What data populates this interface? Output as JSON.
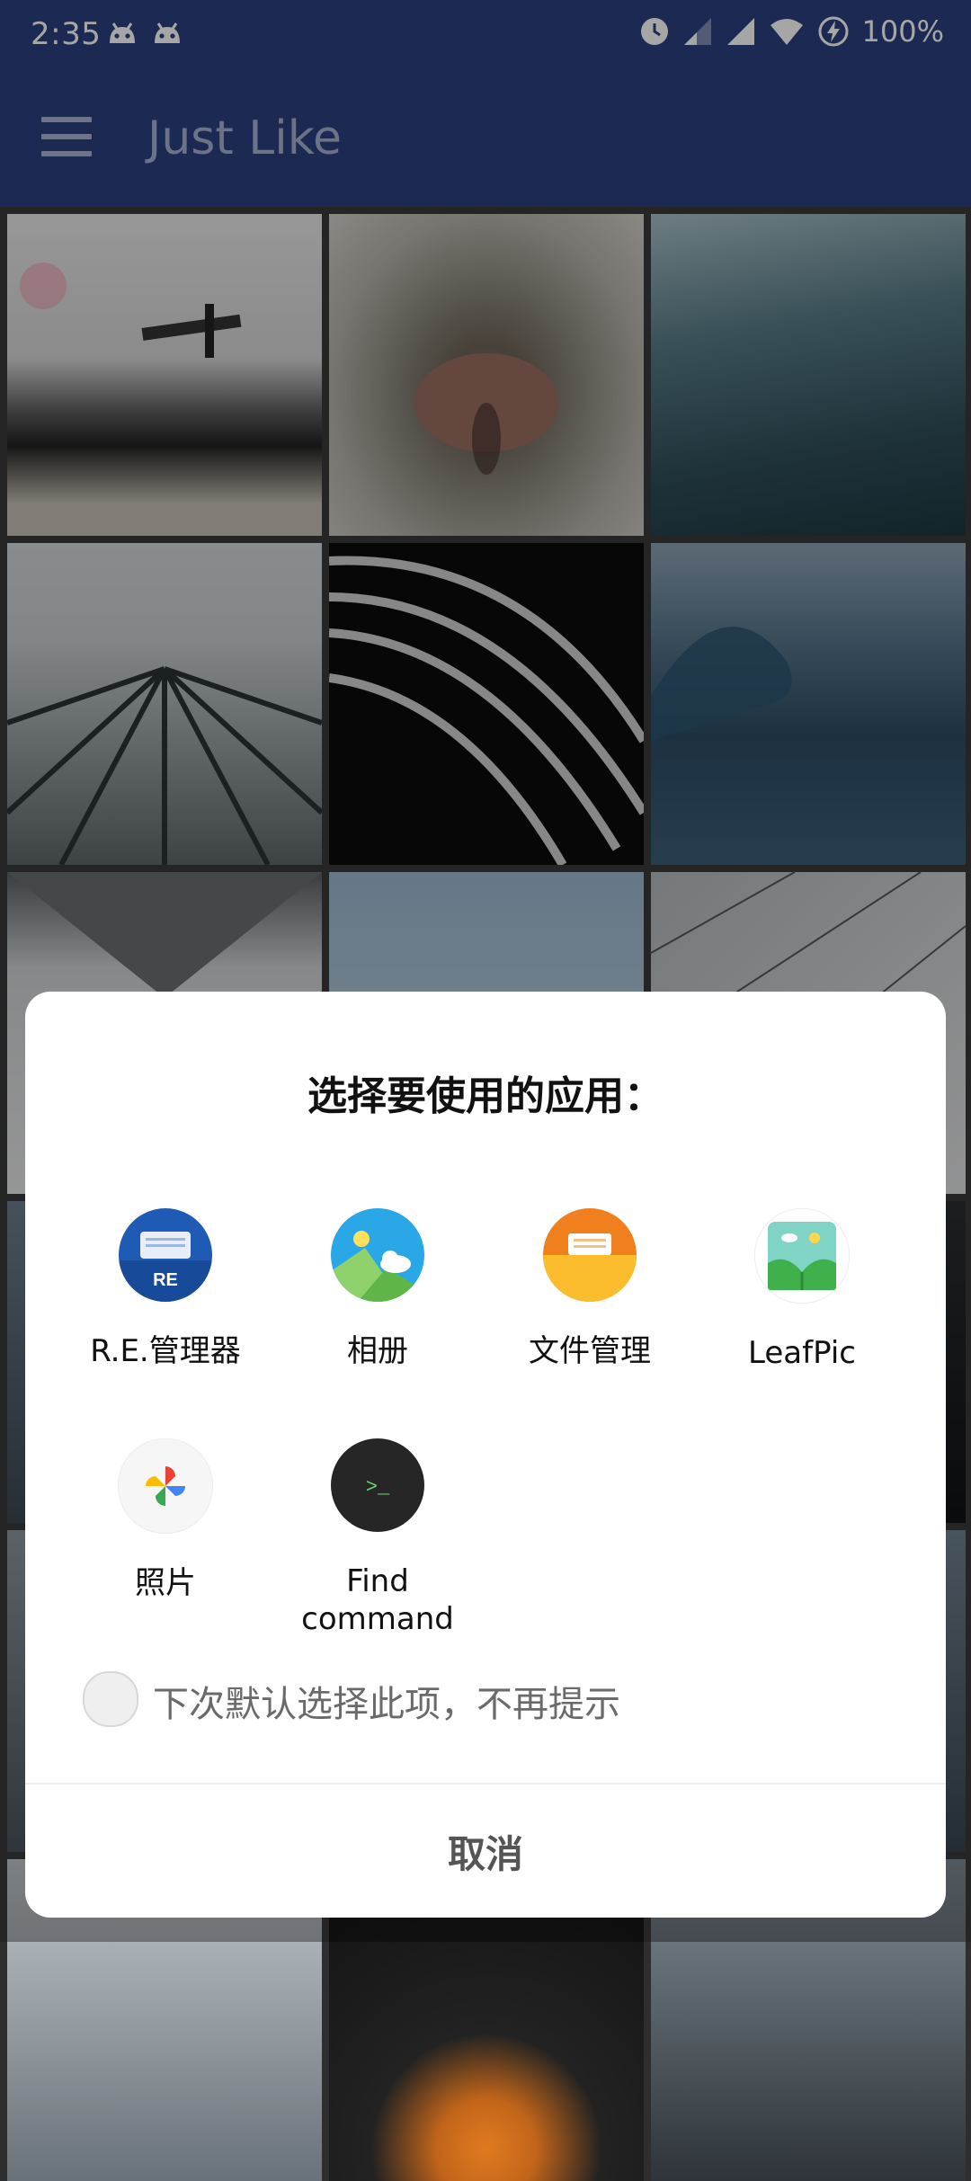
{
  "status_bar": {
    "time": "2:35",
    "battery": "100%",
    "icons": [
      "android-icon",
      "android-icon",
      "alarm-icon",
      "signal-icon",
      "signal-icon",
      "wifi-icon",
      "battery-charging-icon"
    ]
  },
  "app_bar": {
    "menu_icon": "menu-icon",
    "title": "Just Like"
  },
  "dialog": {
    "title": "选择要使用的应用：",
    "apps": [
      {
        "label": "R.E.管理器",
        "icon": "re-manager-icon",
        "badge": "RE"
      },
      {
        "label": "相册",
        "icon": "gallery-icon"
      },
      {
        "label": "文件管理",
        "icon": "file-manager-icon"
      },
      {
        "label": "LeafPic",
        "icon": "leafpic-icon"
      },
      {
        "label": "照片",
        "icon": "google-photos-icon"
      },
      {
        "label": "Find\ncommand",
        "icon": "terminal-icon",
        "badge": ">_"
      }
    ],
    "remember_label": "下次默认选择此项，不再提示",
    "cancel_label": "取消"
  },
  "colors": {
    "app_bar": "#2b3f80",
    "title_text": "#a7b1d1"
  }
}
